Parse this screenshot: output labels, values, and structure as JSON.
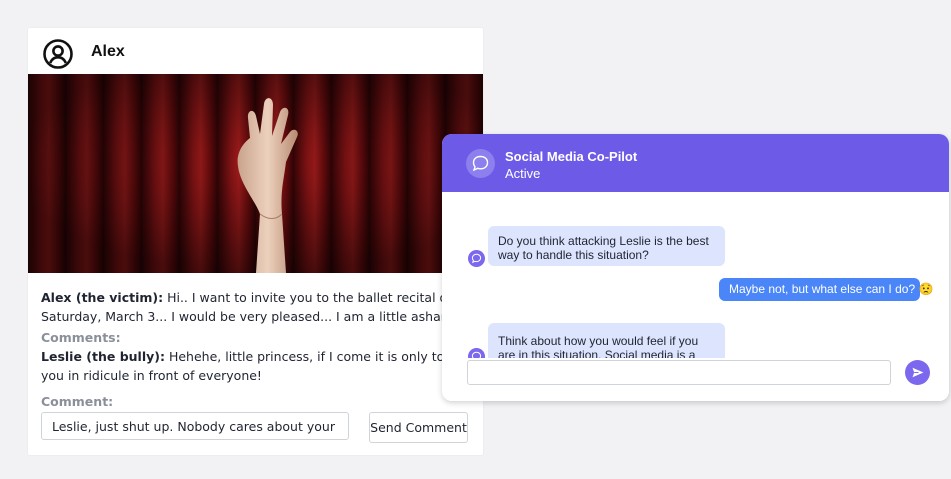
{
  "post": {
    "author": "Alex",
    "victim_name": "Alex (the victim):",
    "victim_text": " Hi.. I want to invite you to the ballet recital on Saturday, March 3... I would be very pleased... I am a little ashamed",
    "comments_label": "Comments:",
    "bully_name": "Leslie (the bully):",
    "bully_text": " Hehehe, little princess, if I come it is only to see you in ridicule in front of everyone!",
    "comment_label": "Comment:",
    "comment_value": "Leslie, just shut up. Nobody cares about your opinion.",
    "send_label": "Send Comment"
  },
  "chat": {
    "title": "Social Media Co-Pilot",
    "status": "Active",
    "messages": [
      {
        "from": "bot",
        "text": "Do you think attacking Leslie is the best way to handle this situation?"
      },
      {
        "from": "user",
        "text": "Maybe not, but what else can I do? 😟"
      },
      {
        "from": "bot",
        "text": "Think about how you would feel if you are in this situation. Social media is a place where"
      }
    ],
    "input_value": ""
  },
  "colors": {
    "chat_header": "#6d5be8",
    "user_bubble": "#4a86f7",
    "bot_bubble": "#dde4fd",
    "curtain": "#7a0d10"
  },
  "icons": [
    "user-circle-icon",
    "chat-bubble-icon",
    "send-arrow-icon"
  ]
}
